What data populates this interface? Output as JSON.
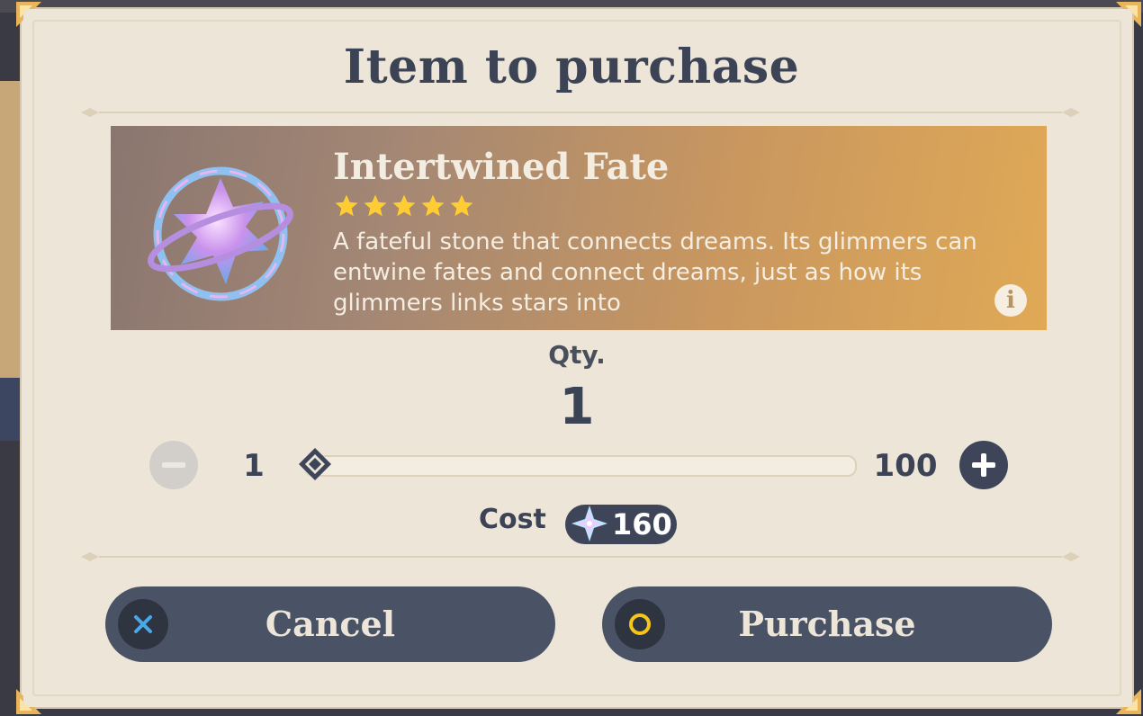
{
  "dialog": {
    "title": "Item to purchase"
  },
  "item": {
    "name": "Intertwined Fate",
    "rarity_stars": 5,
    "description": "A fateful stone that connects dreams. Its glimmers can entwine fates and connect dreams, just as how its glimmers links stars into",
    "icon": "intertwined-fate-icon",
    "info_icon": "info-icon"
  },
  "quantity": {
    "label": "Qty.",
    "value": "1",
    "min": "1",
    "max": "100",
    "slider_fraction": 0
  },
  "cost": {
    "label": "Cost",
    "value": "160",
    "currency_icon": "primogem-icon"
  },
  "actions": {
    "cancel_label": "Cancel",
    "purchase_label": "Purchase"
  },
  "colors": {
    "panel": "#ece5d8",
    "text_dark": "#3b4354",
    "button": "#4a5366",
    "star": "#ffcc33",
    "cancel_icon": "#4aa8e8",
    "purchase_icon": "#f5c518"
  }
}
